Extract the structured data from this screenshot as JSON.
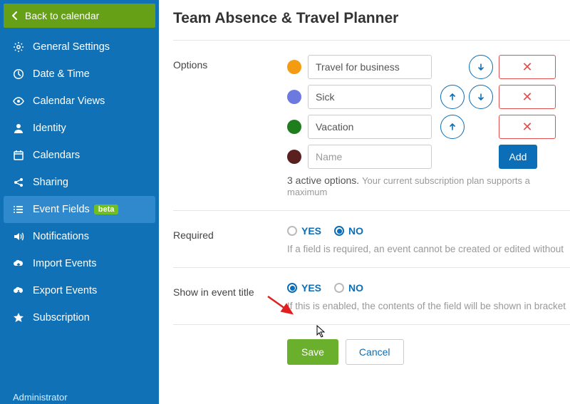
{
  "sidebar": {
    "back_label": "Back to calendar",
    "items": [
      {
        "label": "General Settings"
      },
      {
        "label": "Date & Time"
      },
      {
        "label": "Calendar Views"
      },
      {
        "label": "Identity"
      },
      {
        "label": "Calendars"
      },
      {
        "label": "Sharing"
      },
      {
        "label": "Event Fields",
        "badge": "beta"
      },
      {
        "label": "Notifications"
      },
      {
        "label": "Import Events"
      },
      {
        "label": "Export Events"
      },
      {
        "label": "Subscription"
      }
    ],
    "admin_label": "Administrator"
  },
  "page": {
    "title": "Team Absence & Travel Planner"
  },
  "options": {
    "label": "Options",
    "items": [
      {
        "value": "Travel for business",
        "color": "#f39c12"
      },
      {
        "value": "Sick",
        "color": "#6c7ae0"
      },
      {
        "value": "Vacation",
        "color": "#1e7e1e"
      }
    ],
    "new_placeholder": "Name",
    "new_color": "#5a1f1f",
    "add_label": "Add",
    "note_count": "3 active options.",
    "note_rest": "Your current subscription plan supports a maximum"
  },
  "required": {
    "label": "Required",
    "yes": "YES",
    "no": "NO",
    "selected": "NO",
    "help": "If a field is required, an event cannot be created or edited without"
  },
  "show_title": {
    "label": "Show in event title",
    "yes": "YES",
    "no": "NO",
    "selected": "YES",
    "help": "If this is enabled, the contents of the field will be shown in bracket"
  },
  "footer": {
    "save": "Save",
    "cancel": "Cancel"
  }
}
